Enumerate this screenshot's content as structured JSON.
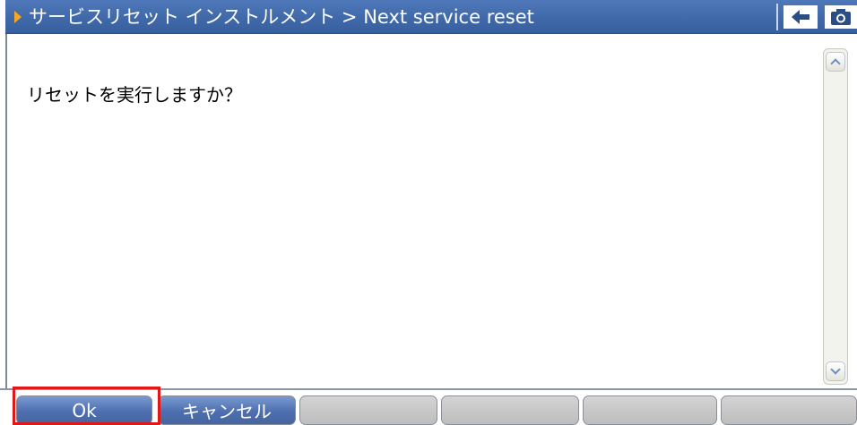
{
  "titlebar": {
    "path_text": "サービスリセット インストルメント > Next service reset",
    "back_icon": "back-arrow-icon",
    "camera_icon": "camera-icon",
    "colors": {
      "bar": "#4a72b4",
      "arrow": "#f5a623"
    }
  },
  "content": {
    "message": "リセットを実行しますか？"
  },
  "scrollbar": {
    "up_icon": "chevron-up-icon",
    "down_icon": "chevron-down-icon"
  },
  "buttons": {
    "ok_label": "Ok",
    "cancel_label": "キャンセル",
    "empty_labels": [
      "",
      "",
      "",
      ""
    ]
  },
  "highlight": {
    "target": "ok-button",
    "color": "#e01818"
  }
}
